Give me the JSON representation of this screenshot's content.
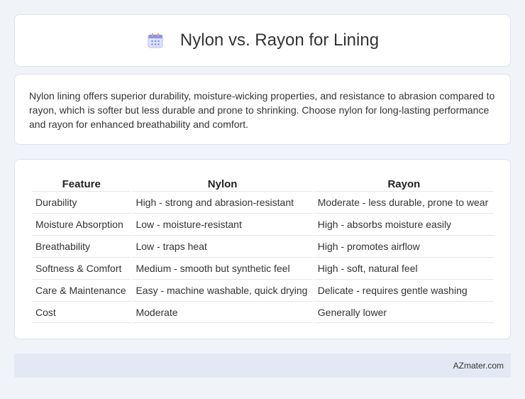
{
  "header": {
    "title": "Nylon vs. Rayon for Lining",
    "icon": "calendar-icon"
  },
  "summary": {
    "text": "Nylon lining offers superior durability, moisture-wicking properties, and resistance to abrasion compared to rayon, which is softer but less durable and prone to shrinking. Choose nylon for long-lasting performance and rayon for enhanced breathability and comfort."
  },
  "table": {
    "headers": [
      "Feature",
      "Nylon",
      "Rayon"
    ],
    "rows": [
      [
        "Durability",
        "High - strong and abrasion-resistant",
        "Moderate - less durable, prone to wear"
      ],
      [
        "Moisture Absorption",
        "Low - moisture-resistant",
        "High - absorbs moisture easily"
      ],
      [
        "Breathability",
        "Low - traps heat",
        "High - promotes airflow"
      ],
      [
        "Softness & Comfort",
        "Medium - smooth but synthetic feel",
        "High - soft, natural feel"
      ],
      [
        "Care & Maintenance",
        "Easy - machine washable, quick drying",
        "Delicate - requires gentle washing"
      ],
      [
        "Cost",
        "Moderate",
        "Generally lower"
      ]
    ]
  },
  "footer": {
    "brand": "AZmater.com"
  },
  "colors": {
    "background": "#f0f3f8",
    "card": "#ffffff",
    "footer": "#e3e9f4",
    "icon_accent": "#7b83e8"
  }
}
